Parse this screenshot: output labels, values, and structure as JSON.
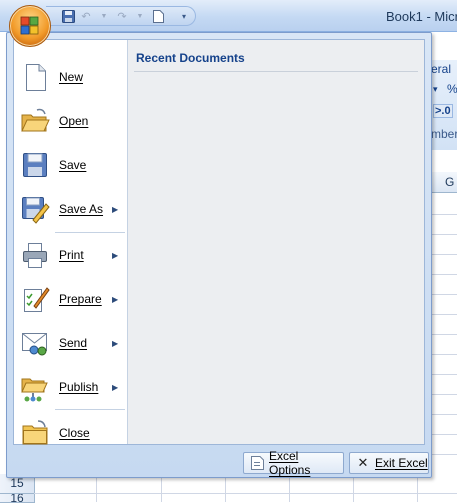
{
  "window": {
    "title": "Book1 - Micr"
  },
  "quick_access": {
    "save_icon": "save-icon",
    "undo_icon": "undo-icon",
    "redo_icon": "redo-icon",
    "new_icon": "new-doc-icon",
    "customize_icon": "customize-qat-icon"
  },
  "ribbon": {
    "number_format_fragment": "eral",
    "dropdown_fragment": "▾",
    "percent_fragment": "%",
    "decimal_fragment": ">.0",
    "group_fragment": "mber"
  },
  "grid": {
    "column_header": "G",
    "row_numbers": [
      "15",
      "16"
    ]
  },
  "office_menu": {
    "commands": [
      {
        "label": "New",
        "icon": "new-doc-icon",
        "has_submenu": false
      },
      {
        "label": "Open",
        "icon": "open-folder-icon",
        "has_submenu": false
      },
      {
        "label": "Save",
        "icon": "save-icon",
        "has_submenu": false
      },
      {
        "label": "Save As",
        "icon": "save-as-icon",
        "has_submenu": true
      },
      {
        "label": "Print",
        "icon": "printer-icon",
        "has_submenu": true
      },
      {
        "label": "Prepare",
        "icon": "prepare-icon",
        "has_submenu": true
      },
      {
        "label": "Send",
        "icon": "send-icon",
        "has_submenu": true
      },
      {
        "label": "Publish",
        "icon": "publish-icon",
        "has_submenu": true
      },
      {
        "label": "Close",
        "icon": "close-folder-icon",
        "has_submenu": false
      }
    ],
    "recent_documents": {
      "title": "Recent Documents",
      "items": []
    },
    "footer": {
      "options_label": "Excel Options",
      "exit_label": "Exit Excel"
    }
  },
  "colors": {
    "accent": "#15428b",
    "menu_bg": "#c6d9f1",
    "recent_bg": "#eceef1"
  }
}
